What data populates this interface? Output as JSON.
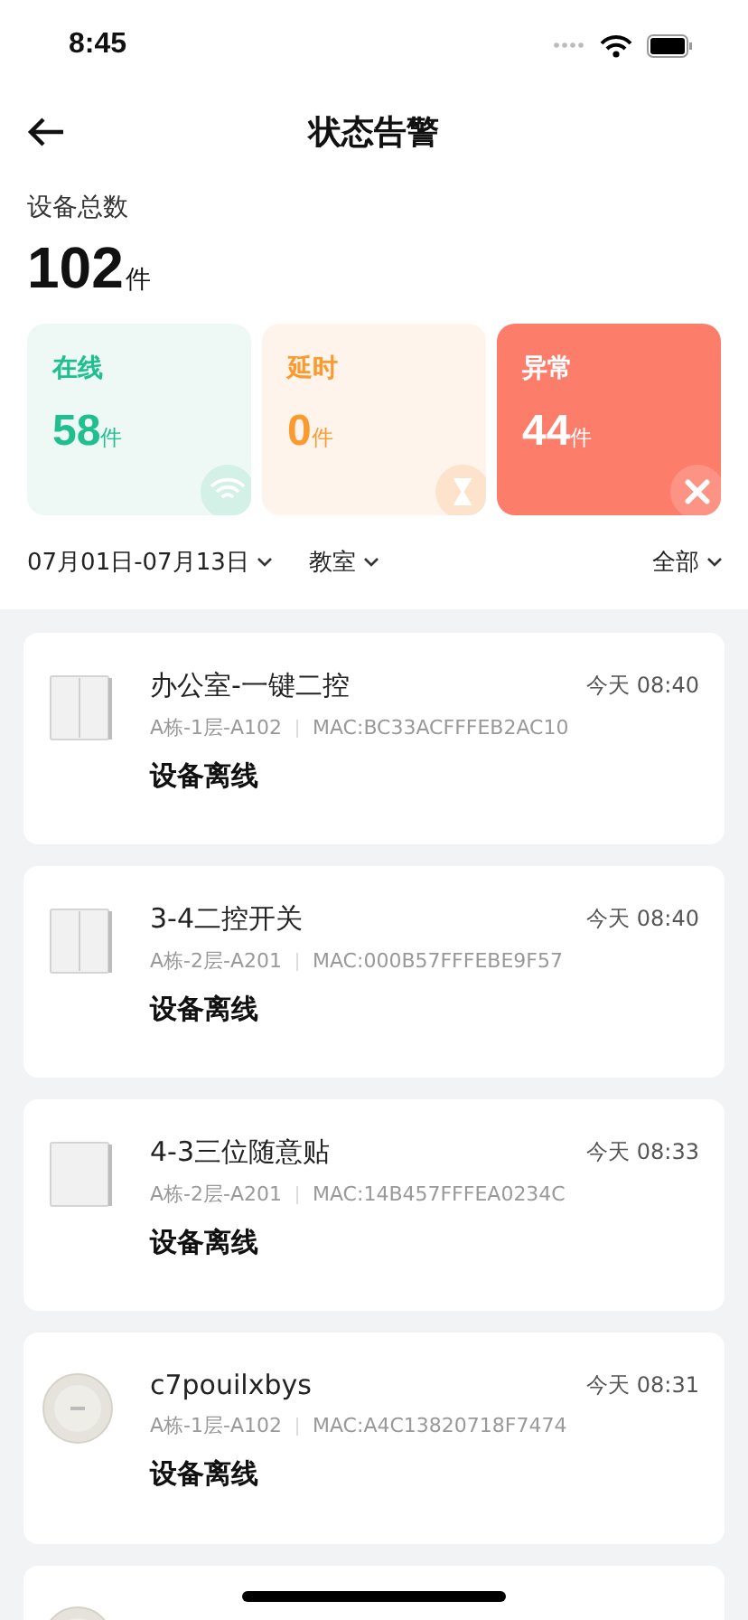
{
  "status_bar": {
    "time": "8:45"
  },
  "header": {
    "title": "状态告警"
  },
  "summary": {
    "label": "设备总数",
    "count": "102",
    "unit": "件"
  },
  "stats": [
    {
      "kind": "online",
      "label": "在线",
      "count": "58",
      "unit": "件"
    },
    {
      "kind": "delay",
      "label": "延时",
      "count": "0",
      "unit": "件"
    },
    {
      "kind": "abnormal",
      "label": "异常",
      "count": "44",
      "unit": "件"
    }
  ],
  "filters": [
    {
      "label": "07月01日-07月13日"
    },
    {
      "label": "教室"
    },
    {
      "label": "全部"
    }
  ],
  "alerts": [
    {
      "kind": "double-switch",
      "name": "办公室-一键二控",
      "time": "今天 08:40",
      "location": "A栋-1层-A102",
      "mac": "MAC:BC33ACFFFEB2AC10",
      "message": "设备离线"
    },
    {
      "kind": "double-switch",
      "name": "3-4二控开关",
      "time": "今天 08:40",
      "location": "A栋-2层-A201",
      "mac": "MAC:000B57FFFEBE9F57",
      "message": "设备离线"
    },
    {
      "kind": "single-switch",
      "name": "4-3三位随意贴",
      "time": "今天 08:33",
      "location": "A栋-2层-A201",
      "mac": "MAC:14B457FFFEA0234C",
      "message": "设备离线"
    },
    {
      "kind": "round-sensor",
      "name": "c7pouilxbys",
      "time": "今天 08:31",
      "location": "A栋-1层-A102",
      "mac": "MAC:A4C13820718F7474",
      "message": "设备离线"
    },
    {
      "kind": "round-sensor"
    }
  ]
}
